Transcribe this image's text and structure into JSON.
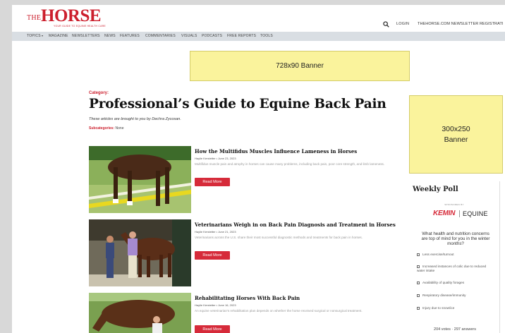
{
  "header": {
    "logo_the": "THE",
    "logo_horse": "HORSE",
    "logo_tagline": "YOUR GUIDE TO EQUINE HEALTH CARE",
    "login": "LOGIN",
    "newsletter_registration": "THEHORSE.COM NEWSLETTER REGISTRATI",
    "search_icon": "search-icon"
  },
  "nav": {
    "items": [
      {
        "label": "TOPICS",
        "icon": "caret-down-icon"
      },
      {
        "label": "MAGAZINE"
      },
      {
        "label": "NEWSLETTERS"
      },
      {
        "label": "NEWS"
      },
      {
        "label": "FEATURES"
      },
      {
        "label": "COMMENTARIES"
      },
      {
        "label": "VISUALS"
      },
      {
        "label": "PODCASTS"
      },
      {
        "label": "FREE REPORTS"
      },
      {
        "label": "TOOLS"
      }
    ]
  },
  "banners": {
    "top": "728x90 Banner",
    "side_line1": "300x250",
    "side_line2": "Banner"
  },
  "page": {
    "category_label": "Category:",
    "title": "Professional’s Guide to Equine Back Pain",
    "subtitle": "These articles are brought to you by Dechra Zycosan.",
    "subcategories_label": "Subcategories:",
    "subcategories_value": "None"
  },
  "articles": [
    {
      "title": "How the Multifidus Muscles Influence Lameness in Horses",
      "meta": "Haylie Kerstetter • June 23, 2023",
      "summary": "Multifidus muscle pain and atrophy in horses can cause many problems, including back pain, poor core strength, and limb lameness.",
      "button": "Read More"
    },
    {
      "title": "Veterinarians Weigh in on Back Pain Diagnosis and Treatment in Horses",
      "meta": "Haylie Kerstetter • June 21, 2023",
      "summary": "Veterinarians across the U.S. share their most successful diagnostic methods and treatments for back pain in horses.",
      "button": "Read More"
    },
    {
      "title": "Rehabilitating Horses With Back Pain",
      "meta": "Haylie Kerstetter • June 16, 2023",
      "summary": "An equine veterinarian's rehabilitation plan depends on whether the horse received surgical or nonsurgical treatment.",
      "button": "Read More"
    }
  ],
  "poll": {
    "title": "Weekly Poll",
    "sponsored_by": "SPONSORED BY",
    "sponsor_name": "KEMIN",
    "sponsor_division": "EQUINE",
    "question": "What health and nutrition concerns are top of mind for you in the winter months?",
    "options": [
      "Less exercise/turnout",
      "Increased instances of colic due to reduced water intake",
      "Availability of quality forages",
      "Respiratory disease/immunity",
      "Injury due to snow/ice"
    ],
    "votes": "204 votes · 297 answers"
  },
  "colors": {
    "brand_red": "#cc1f2d",
    "button_red": "#d62b3a",
    "banner_yellow": "#faf39c",
    "nav_bg": "#d9dee3"
  }
}
